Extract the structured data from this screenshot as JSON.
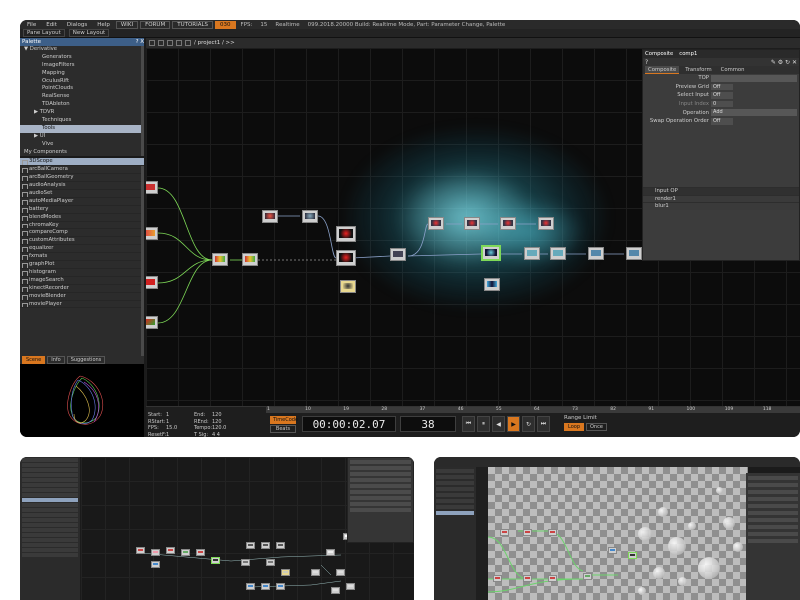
{
  "menu": {
    "items": [
      "File",
      "Edit",
      "Dialogs",
      "Help"
    ],
    "boxes": [
      "WIKI",
      "FORUM",
      "TUTORIALS"
    ],
    "orange_box": "030",
    "fps_label": "FPS:",
    "fps_value": "15",
    "mode": "Realtime",
    "build": "099.2018.20000  Build: Realtime Mode, Part: Parameter Change, Palette"
  },
  "toolbar": {
    "pane_layout": "Pane Layout",
    "new_layout": "New Layout"
  },
  "palette": {
    "title": "Palette",
    "header_controls": "? X",
    "categories": [
      {
        "label": "▼ Derivative",
        "type": "cat"
      },
      {
        "label": "Generators",
        "type": "sub"
      },
      {
        "label": "ImageFilters",
        "type": "sub"
      },
      {
        "label": "Mapping",
        "type": "sub"
      },
      {
        "label": "OculusRift",
        "type": "sub"
      },
      {
        "label": "PointClouds",
        "type": "sub"
      },
      {
        "label": "RealSense",
        "type": "sub"
      },
      {
        "label": "TDAbleton",
        "type": "sub"
      },
      {
        "label": "▶ TDVR",
        "type": "sub2"
      },
      {
        "label": "Techniques",
        "type": "sub"
      },
      {
        "label": "Tools",
        "type": "sel"
      },
      {
        "label": "▶ UI",
        "type": "sub2"
      },
      {
        "label": "Vive",
        "type": "sub"
      },
      {
        "label": "My Components",
        "type": "cat"
      }
    ],
    "components": [
      "3DScope",
      "arcBallCamera",
      "arcBallGeometry",
      "audioAnalysis",
      "audioSet",
      "autoMediaPlayer",
      "battery",
      "blendModes",
      "chromaKey",
      "compareComp",
      "customAttributes",
      "equalizer",
      "fxmats",
      "graphPlot",
      "histogram",
      "imageSearch",
      "kinectRecorder",
      "movieBlender",
      "moviePlayer"
    ],
    "selected_component": "3DScope"
  },
  "preview": {
    "tabs": [
      "Scene",
      "Info",
      "Suggestions"
    ],
    "active": "Scene"
  },
  "network": {
    "path": "/ project1 / >>"
  },
  "timeline": {
    "ruler": [
      "1",
      "10",
      "19",
      "28",
      "37",
      "46",
      "55",
      "64",
      "73",
      "82",
      "91",
      "100",
      "109",
      "118"
    ],
    "info": [
      [
        "Start:",
        "1",
        "End:",
        "120"
      ],
      [
        "RStart:",
        "1",
        "REnd:",
        "120"
      ],
      [
        "FPS:",
        "15.0",
        "Tempo:",
        "120.0"
      ],
      [
        "ResetF:",
        "1",
        "T Sig:",
        "4   4"
      ]
    ],
    "timecode_btn": "TimeCode",
    "beats_btn": "Beats",
    "timecode": "00:00:02.07",
    "frame": "38",
    "transport": [
      "⏮",
      "⏸",
      "◀",
      "▶",
      "↻",
      "⏭"
    ],
    "range_label": "Range Limit",
    "range_btns": [
      "Loop",
      "Once"
    ]
  },
  "params": {
    "title": "Composite",
    "comp_name": "comp1",
    "tabs": [
      "Composite",
      "Transform",
      "Common"
    ],
    "rows": [
      {
        "label": "TOP",
        "value": "",
        "dim": false
      },
      {
        "label": "Preview Grid",
        "value": "Off",
        "dim": false
      },
      {
        "label": "Select Input",
        "value": "Off",
        "dim": false
      },
      {
        "label": "Input Index",
        "value": "0",
        "dim": true
      },
      {
        "label": "Operation",
        "value": "Add",
        "dim": false
      },
      {
        "label": "Swap Operation Order",
        "value": "Off",
        "dim": false
      }
    ],
    "input_header": "Input OP",
    "inputs": [
      "render1",
      "blur1"
    ]
  },
  "colors": {
    "accent": "#d9771f",
    "palette_header": "#3d5f88",
    "selection": "#a8b4c6",
    "wire": "#7ed957"
  }
}
